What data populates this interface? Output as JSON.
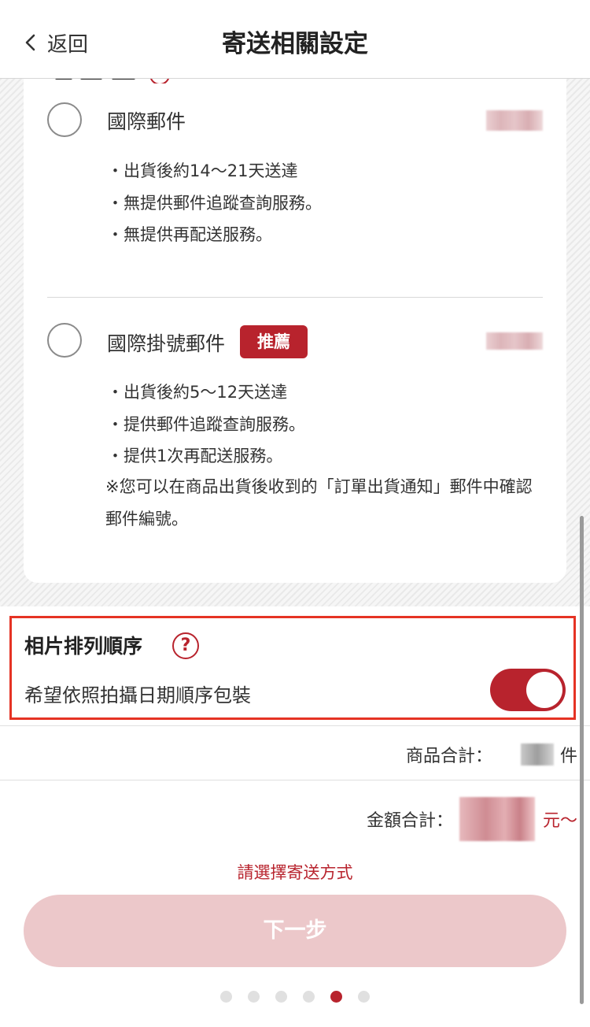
{
  "header": {
    "back_label": "返回",
    "title": "寄送相關設定"
  },
  "shipping_options": [
    {
      "name": "國際郵件",
      "selected": false,
      "badge": "",
      "bullets": [
        "・出貨後約14～21天送達",
        "・無提供郵件追蹤查詢服務。",
        "・無提供再配送服務。"
      ],
      "note": ""
    },
    {
      "name": "國際掛號郵件",
      "selected": false,
      "badge": "推薦",
      "bullets": [
        "・出貨後約5～12天送達",
        "・提供郵件追蹤查詢服務。",
        "・提供1次再配送服務。"
      ],
      "note": "※您可以在商品出貨後收到的「訂單出貨通知」郵件中確認郵件編號。"
    }
  ],
  "photo_order": {
    "title": "相片排列順序",
    "help_icon": "question-circle-icon",
    "toggle_label": "希望依照拍攝日期順序包裝",
    "toggle_on": true
  },
  "summary": {
    "items_label": "商品合計：",
    "items_unit": "件",
    "amount_label": "金額合計：",
    "amount_unit": "元～"
  },
  "hint": "請選擇寄送方式",
  "next_button": "下一步",
  "pagination": {
    "total": 6,
    "active_index": 4
  },
  "colors": {
    "accent": "#b8232d",
    "highlight_border": "#e53324",
    "disabled_button": "#ecc8ca"
  }
}
